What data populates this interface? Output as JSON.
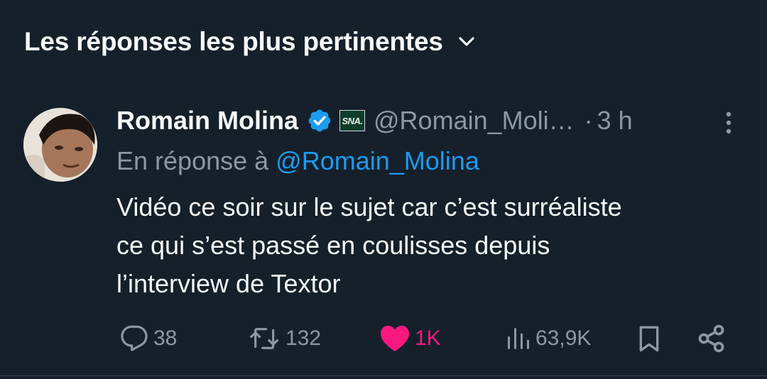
{
  "sort": {
    "label": "Les réponses les plus pertinentes"
  },
  "tweet": {
    "author_name": "Romain Molina",
    "affiliate_badge": "SNA.",
    "handle": "@Romain_Moli…",
    "separator": "·",
    "time": "3 h",
    "reply_prefix": "En réponse à",
    "reply_mention": "@Romain_Molina",
    "text_lines": [
      "Vidéo ce soir sur le sujet car c’est surréaliste",
      "ce qui s’est passé en coulisses depuis",
      "l’interview de Textor"
    ]
  },
  "actions": {
    "replies": "38",
    "reposts": "132",
    "likes": "1K",
    "views": "63,9K"
  },
  "colors": {
    "background": "#15202b",
    "text": "#f7f9f9",
    "secondary": "#8b98a5",
    "accent": "#1d9bf0",
    "like": "#f91880"
  },
  "icons": [
    "chevron-down-icon",
    "verified-icon",
    "more-icon",
    "reply-icon",
    "repost-icon",
    "heart-icon",
    "views-icon",
    "bookmark-icon",
    "share-icon"
  ]
}
